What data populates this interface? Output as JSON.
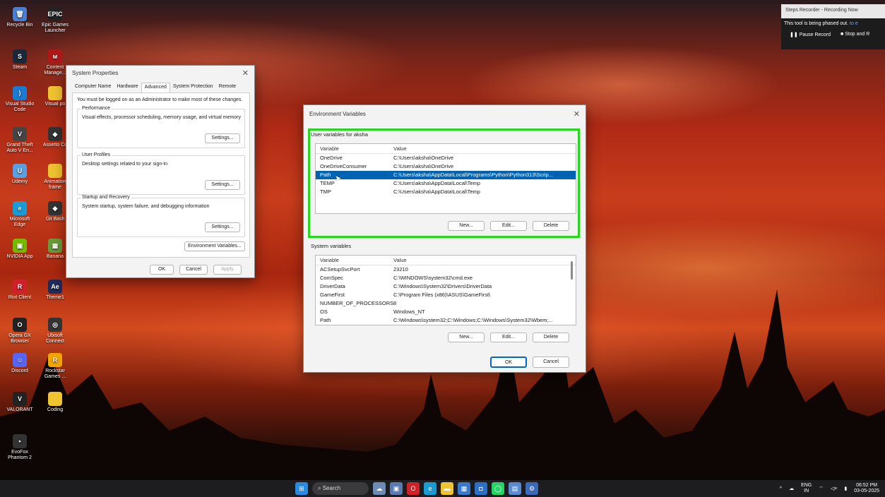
{
  "desktop": {
    "icons": [
      {
        "label": "Recycle Bin",
        "symbol": "🗑",
        "color": "#4a7fd0"
      },
      {
        "label": "Epic Games Launcher",
        "symbol": "EPIC",
        "color": "#222"
      },
      {
        "label": "Steam",
        "symbol": "S",
        "color": "#1b2838"
      },
      {
        "label": "Content Manage...",
        "symbol": "ᴍ",
        "color": "#b01818"
      },
      {
        "label": "Visual Studio Code",
        "symbol": "⟩",
        "color": "#1a7bd4"
      },
      {
        "label": "Visual po",
        "symbol": "",
        "color": "#f0c330"
      },
      {
        "label": "Grand Theft Auto V En...",
        "symbol": "V",
        "color": "#444"
      },
      {
        "label": "Assetto Co",
        "symbol": "◆",
        "color": "#333"
      },
      {
        "label": "Udemy",
        "symbol": "U",
        "color": "#5aa0e0"
      },
      {
        "label": "Animation frame",
        "symbol": "",
        "color": "#f0c330"
      },
      {
        "label": "Microsoft Edge",
        "symbol": "e",
        "color": "#1a9bd4"
      },
      {
        "label": "Git Bash",
        "symbol": "◆",
        "color": "#333"
      },
      {
        "label": "NVIDIA App",
        "symbol": "▣",
        "color": "#76b900"
      },
      {
        "label": "Banana",
        "symbol": "▦",
        "color": "#6a9b3a"
      },
      {
        "label": "Riot Client",
        "symbol": "R",
        "color": "#d0202a"
      },
      {
        "label": "Theme1",
        "symbol": "Ae",
        "color": "#1e2a5a"
      },
      {
        "label": "Opera GX Browser",
        "symbol": "O",
        "color": "#222"
      },
      {
        "label": "Ubisoft Connect",
        "symbol": "◎",
        "color": "#333"
      },
      {
        "label": "Discord",
        "symbol": "☺",
        "color": "#5865f2"
      },
      {
        "label": "Rockstar Games ...",
        "symbol": "R",
        "color": "#f0a400"
      },
      {
        "label": "VALORANT",
        "symbol": "V",
        "color": "#222"
      },
      {
        "label": "Coding",
        "symbol": "",
        "color": "#f0c330"
      },
      {
        "label": "EvoFox Phantom 2",
        "symbol": "▪",
        "color": "#333"
      }
    ]
  },
  "system_properties": {
    "title": "System Properties",
    "tabs": [
      "Computer Name",
      "Hardware",
      "Advanced",
      "System Protection",
      "Remote"
    ],
    "active_tab": "Advanced",
    "note": "You must be logged on as an Administrator to make most of these changes.",
    "performance": {
      "label": "Performance",
      "desc": "Visual effects, processor scheduling, memory usage, and virtual memory",
      "button": "Settings..."
    },
    "user_profiles": {
      "label": "User Profiles",
      "desc": "Desktop settings related to your sign-in",
      "button": "Settings..."
    },
    "startup": {
      "label": "Startup and Recovery",
      "desc": "System startup, system failure, and debugging information",
      "button": "Settings..."
    },
    "env_button": "Environment Variables...",
    "ok": "OK",
    "cancel": "Cancel",
    "apply": "Apply"
  },
  "env_vars": {
    "title": "Environment Variables",
    "user_label": "User variables for aksha",
    "col_variable": "Variable",
    "col_value": "Value",
    "user_rows": [
      {
        "name": "OneDrive",
        "value": "C:\\Users\\aksha\\OneDrive"
      },
      {
        "name": "OneDriveConsumer",
        "value": "C:\\Users\\aksha\\OneDrive"
      },
      {
        "name": "Path",
        "value": "C:\\Users\\aksha\\AppData\\Local\\Programs\\Python\\Python313\\Scrip..."
      },
      {
        "name": "TEMP",
        "value": "C:\\Users\\aksha\\AppData\\Local\\Temp"
      },
      {
        "name": "TMP",
        "value": "C:\\Users\\aksha\\AppData\\Local\\Temp"
      }
    ],
    "selected_user_row": "Path",
    "system_label": "System variables",
    "system_rows": [
      {
        "name": "ACSetupSvcPort",
        "value": "23210"
      },
      {
        "name": "ComSpec",
        "value": "C:\\WINDOWS\\system32\\cmd.exe"
      },
      {
        "name": "DriverData",
        "value": "C:\\Windows\\System32\\Drivers\\DriverData"
      },
      {
        "name": "GameFirst",
        "value": "C:\\Program Files (x86)\\ASUS\\GameFirst\\"
      },
      {
        "name": "NUMBER_OF_PROCESSORS",
        "value": "8"
      },
      {
        "name": "OS",
        "value": "Windows_NT"
      },
      {
        "name": "Path",
        "value": "C:\\Windows\\system32;C:\\Windows;C:\\Windows\\System32\\Wbem;..."
      }
    ],
    "new": "New...",
    "edit": "Edit...",
    "delete": "Delete",
    "ok": "OK",
    "cancel": "Cancel",
    "highlight_color": "#29d61e"
  },
  "steps_recorder": {
    "title": "Steps Recorder - Recording Now",
    "message": "This tool is being phased out.",
    "message_tail": "to e",
    "pause": "Pause Record",
    "stop": "Stop and R"
  },
  "taskbar": {
    "search": "Search",
    "apps": [
      {
        "icon": "windows-icon",
        "symbol": "⊞",
        "color": "#2a8ae0"
      },
      {
        "icon": "search-icon",
        "symbol": "",
        "color": ""
      },
      {
        "icon": "widgets-icon",
        "symbol": "☁",
        "color": "#6c8bb5"
      },
      {
        "icon": "taskview-icon",
        "symbol": "▣",
        "color": "#5a7ab0"
      },
      {
        "icon": "opera-icon",
        "symbol": "O",
        "color": "#d0202a"
      },
      {
        "icon": "edge-icon",
        "symbol": "e",
        "color": "#1a9bd4"
      },
      {
        "icon": "explorer-icon",
        "symbol": "▬",
        "color": "#f0c330"
      },
      {
        "icon": "store-icon",
        "symbol": "▦",
        "color": "#3a78c8"
      },
      {
        "icon": "outlook-icon",
        "symbol": "◘",
        "color": "#2a6fc8"
      },
      {
        "icon": "whatsapp-icon",
        "symbol": "◯",
        "color": "#25d366"
      },
      {
        "icon": "steps-icon",
        "symbol": "▤",
        "color": "#5a8ad0"
      },
      {
        "icon": "control-icon",
        "symbol": "⚙",
        "color": "#3a6ab8"
      }
    ],
    "lang_top": "ENG",
    "lang_bottom": "IN",
    "time": "06:52 PM",
    "date": "03-05-2025"
  }
}
